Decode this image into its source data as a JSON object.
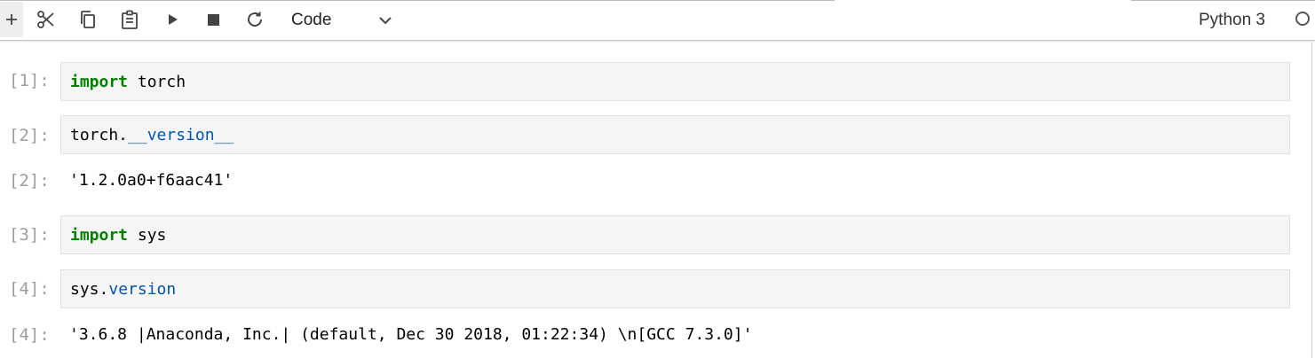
{
  "toolbar": {
    "icons": [
      "add-icon",
      "cut-icon",
      "copy-icon",
      "paste-icon",
      "run-icon",
      "stop-icon",
      "restart-icon",
      "chevron-down-icon"
    ],
    "cell_type": "Code",
    "kernel_name": "Python 3"
  },
  "cells": [
    {
      "prompt": "[1]:",
      "code": {
        "kw": "import",
        "rest": " torch"
      }
    },
    {
      "prompt": "[2]:",
      "code": {
        "obj": "torch.",
        "attr": "__version__"
      },
      "out_prompt": "[2]:",
      "output": "'1.2.0a0+f6aac41'"
    },
    {
      "prompt": "[3]:",
      "code": {
        "kw": "import",
        "rest": " sys"
      }
    },
    {
      "prompt": "[4]:",
      "code": {
        "obj": "sys.",
        "attr": "version"
      },
      "out_prompt": "[4]:",
      "output": "'3.6.8 |Anaconda, Inc.| (default, Dec 30 2018, 01:22:34) \\n[GCC 7.3.0]'"
    }
  ],
  "colors": {
    "keyword": "#008000",
    "attribute": "#0055aa",
    "prompt": "#9e9e9e",
    "input_bg": "#f5f5f5"
  }
}
